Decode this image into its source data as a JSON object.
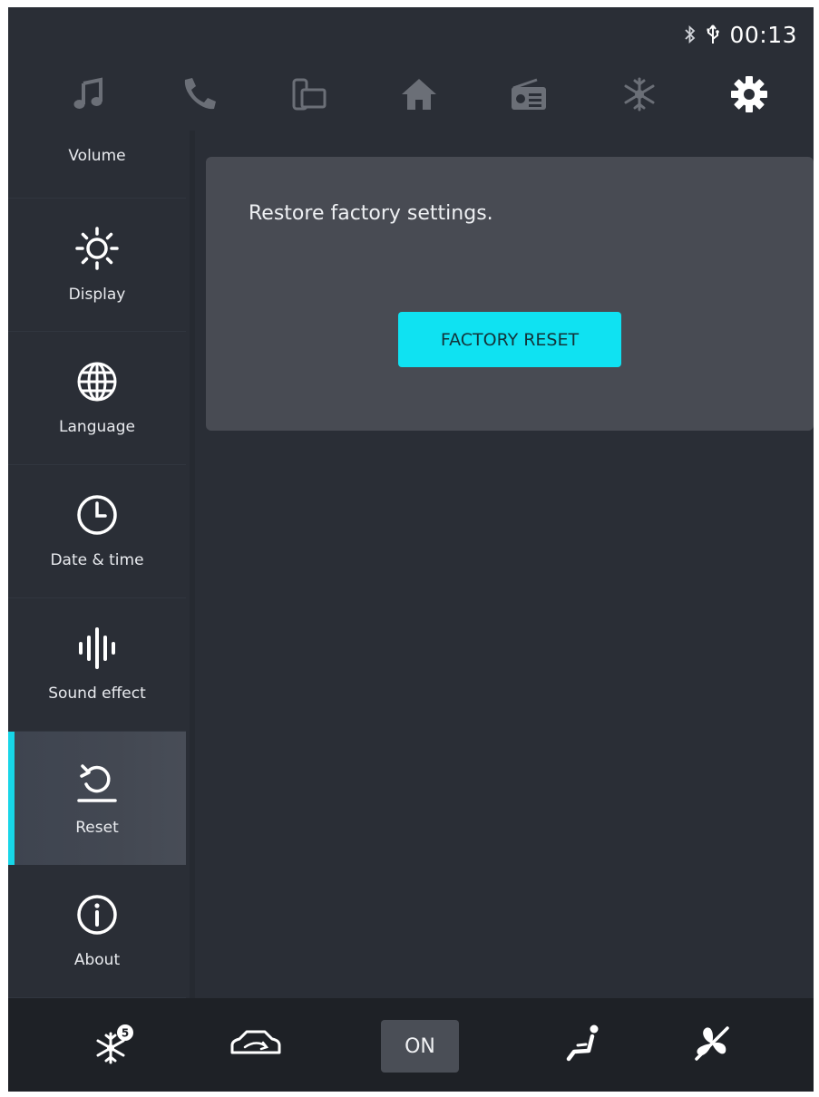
{
  "status": {
    "time": "00:13",
    "icons": [
      "bluetooth-icon",
      "usb-icon"
    ]
  },
  "topnav": {
    "items": [
      {
        "icon": "music-icon",
        "active": false
      },
      {
        "icon": "phone-icon",
        "active": false
      },
      {
        "icon": "screen-mirror-icon",
        "active": false
      },
      {
        "icon": "home-icon",
        "active": false
      },
      {
        "icon": "radio-icon",
        "active": false
      },
      {
        "icon": "climate-icon",
        "active": false
      },
      {
        "icon": "settings-gear-icon",
        "active": true
      }
    ],
    "active_color": "#ffffff",
    "inactive_color": "#6b6f77"
  },
  "sidebar": {
    "items": [
      {
        "label": "Volume",
        "icon": "volume-icon"
      },
      {
        "label": "Display",
        "icon": "sun-icon"
      },
      {
        "label": "Language",
        "icon": "globe-icon"
      },
      {
        "label": "Date & time",
        "icon": "clock-icon"
      },
      {
        "label": "Sound effect",
        "icon": "sound-wave-icon"
      },
      {
        "label": "Reset",
        "icon": "reset-icon",
        "active": true
      },
      {
        "label": "About",
        "icon": "info-icon"
      }
    ],
    "accent_color": "#17d6e8"
  },
  "content": {
    "description": "Restore factory settings.",
    "button_label": "FACTORY RESET",
    "button_color": "#0fe2f2"
  },
  "bottom_bar": {
    "items": [
      {
        "icon": "ac-snowflake-icon",
        "badge": "5"
      },
      {
        "icon": "car-recirculation-icon"
      },
      {
        "label": "ON"
      },
      {
        "icon": "seat-airflow-icon"
      },
      {
        "icon": "fan-off-icon"
      }
    ]
  }
}
